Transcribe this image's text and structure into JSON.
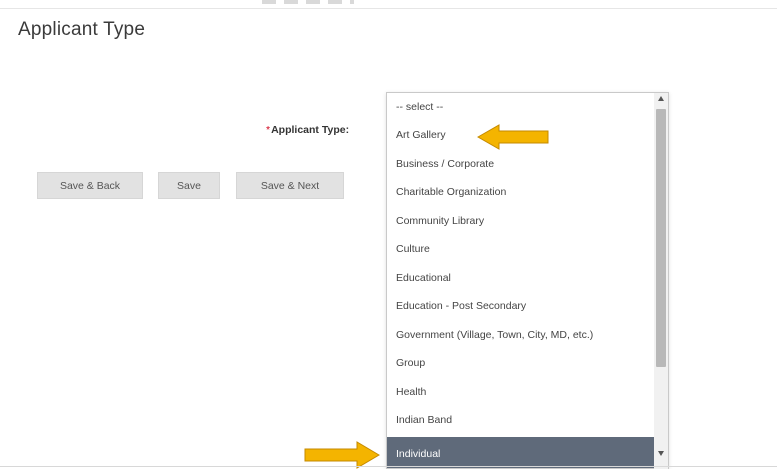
{
  "page": {
    "title": "Applicant Type"
  },
  "field": {
    "required_mark": "*",
    "label": "Applicant Type:"
  },
  "buttons": {
    "save_back": "Save & Back",
    "save": "Save",
    "save_next": "Save & Next"
  },
  "dropdown": {
    "options": [
      "-- select --",
      "Art Gallery",
      "Business / Corporate",
      "Charitable Organization",
      "Community Library",
      "Culture",
      "Educational",
      "Education - Post Secondary",
      "Government (Village, Town, City, MD, etc.)",
      "Group",
      "Health",
      "Indian Band",
      "Individual"
    ],
    "selected": "Individual",
    "highlight_color": "#5f6a7a"
  },
  "annotations": {
    "arrow_color": "#f4b400",
    "arrow_icon": "arrow-left-icon"
  }
}
